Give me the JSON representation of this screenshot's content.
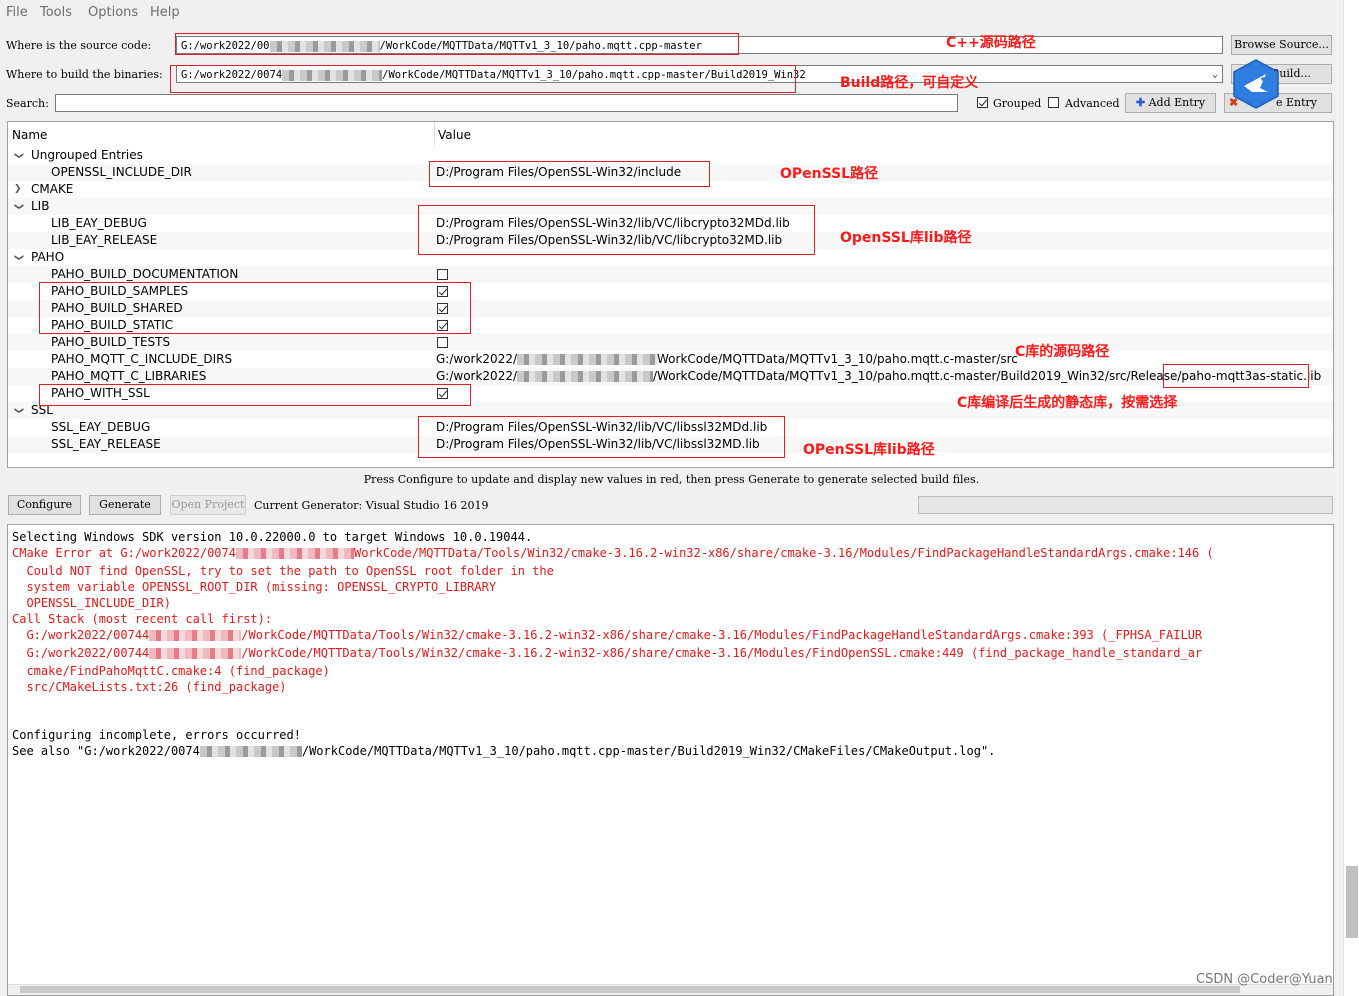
{
  "menu": {
    "file": "File",
    "tools": "Tools",
    "options": "Options",
    "help": "Help"
  },
  "source": {
    "label": "Where is the source code:",
    "value_prefix": "G:/work2022/00",
    "value_suffix": "/WorkCode/MQTTData/MQTTv1_3_10/paho.mqtt.cpp-master",
    "browse": "Browse Source..."
  },
  "build": {
    "label": "Where to build the binaries:",
    "value_prefix": "G:/work2022/0074",
    "value_suffix": "/WorkCode/MQTTData/MQTTv1_3_10/paho.mqtt.cpp-master/Build2019_Win32",
    "browse": "Build..."
  },
  "search": {
    "label": "Search:",
    "value": ""
  },
  "options": {
    "grouped_label": "Grouped",
    "grouped_checked": true,
    "advanced_label": "Advanced",
    "advanced_checked": false,
    "add_entry": "Add Entry",
    "remove_entry": "Remove Entry",
    "remove_entry_visible": "e Entry"
  },
  "tree": {
    "col_name": "Name",
    "col_value": "Value",
    "rows": [
      {
        "name": "Ungrouped Entries",
        "type": "group",
        "expanded": true
      },
      {
        "name": "OPENSSL_INCLUDE_DIR",
        "value": "D:/Program Files/OpenSSL-Win32/include"
      },
      {
        "name": "CMAKE",
        "type": "group",
        "expanded": false
      },
      {
        "name": "LIB",
        "type": "group",
        "expanded": true
      },
      {
        "name": "LIB_EAY_DEBUG",
        "value": "D:/Program Files/OpenSSL-Win32/lib/VC/libcrypto32MDd.lib"
      },
      {
        "name": "LIB_EAY_RELEASE",
        "value": "D:/Program Files/OpenSSL-Win32/lib/VC/libcrypto32MD.lib"
      },
      {
        "name": "PAHO",
        "type": "group",
        "expanded": true
      },
      {
        "name": "PAHO_BUILD_DOCUMENTATION",
        "checkbox": false
      },
      {
        "name": "PAHO_BUILD_SAMPLES",
        "checkbox": true
      },
      {
        "name": "PAHO_BUILD_SHARED",
        "checkbox": true
      },
      {
        "name": "PAHO_BUILD_STATIC",
        "checkbox": true
      },
      {
        "name": "PAHO_BUILD_TESTS",
        "checkbox": false
      },
      {
        "name": "PAHO_MQTT_C_INCLUDE_DIRS",
        "value_prefix": "G:/work2022/",
        "value_suffix": "WorkCode/MQTTData/MQTTv1_3_10/paho.mqtt.c-master/src"
      },
      {
        "name": "PAHO_MQTT_C_LIBRARIES",
        "value_prefix": "G:/work2022/",
        "value_suffix": "/WorkCode/MQTTData/MQTTv1_3_10/paho.mqtt.c-master/Build2019_Win32/src/Release/paho-mqtt3as-static.lib"
      },
      {
        "name": "PAHO_WITH_SSL",
        "checkbox": true
      },
      {
        "name": "SSL",
        "type": "group",
        "expanded": true
      },
      {
        "name": "SSL_EAY_DEBUG",
        "value": "D:/Program Files/OpenSSL-Win32/lib/VC/libssl32MDd.lib"
      },
      {
        "name": "SSL_EAY_RELEASE",
        "value": "D:/Program Files/OpenSSL-Win32/lib/VC/libssl32MD.lib"
      }
    ]
  },
  "annotations": {
    "cpp_src": "C++源码路径",
    "build_path": "Build路径，可自定义",
    "openssl_path": "OPenSSL路径",
    "openssl_lib1": "OpenSSL库lib路径",
    "c_src": "C库的源码路径",
    "c_static": "C库编译后生成的静态库，按需选择",
    "openssl_lib2": "OPenSSL库lib路径"
  },
  "hint": "Press Configure to update and display new values in red, then press Generate to generate selected build files.",
  "actions": {
    "configure": "Configure",
    "generate": "Generate",
    "open_project": "Open Project",
    "generator_label": "Current Generator: Visual Studio 16 2019"
  },
  "output": {
    "l1": "Selecting Windows SDK version 10.0.22000.0 to target Windows 10.0.19044.",
    "l2a": "CMake Error at G:/work2022/0074",
    "l2b": "WorkCode/MQTTData/Tools/Win32/cmake-3.16.2-win32-x86/share/cmake-3.16/Modules/FindPackageHandleStandardArgs.cmake:146 (",
    "l3": "  Could NOT find OpenSSL, try to set the path to OpenSSL root folder in the",
    "l4": "  system variable OPENSSL_ROOT_DIR (missing: OPENSSL_CRYPTO_LIBRARY",
    "l5": "  OPENSSL_INCLUDE_DIR)",
    "l6": "Call Stack (most recent call first):",
    "l7a": "  G:/work2022/00744",
    "l7b": "/WorkCode/MQTTData/Tools/Win32/cmake-3.16.2-win32-x86/share/cmake-3.16/Modules/FindPackageHandleStandardArgs.cmake:393 (_FPHSA_FAILUR",
    "l8a": "  G:/work2022/00744",
    "l8b": "/WorkCode/MQTTData/Tools/Win32/cmake-3.16.2-win32-x86/share/cmake-3.16/Modules/FindOpenSSL.cmake:449 (find_package_handle_standard_ar",
    "l9": "  cmake/FindPahoMqttC.cmake:4 (find_package)",
    "l10": "  src/CMakeLists.txt:26 (find_package)",
    "l11": "Configuring incomplete, errors occurred!",
    "l12a": "See also \"G:/work2022/0074",
    "l12b": "/WorkCode/MQTTData/MQTTv1_3_10/paho.mqtt.cpp-master/Build2019_Win32/CMakeFiles/CMakeOutput.log\"."
  },
  "watermark": "CSDN @Coder@Yuan",
  "colors": {
    "annotation": "#ff1a1a",
    "error": "#e81818",
    "highlight_box": "#e02020"
  }
}
